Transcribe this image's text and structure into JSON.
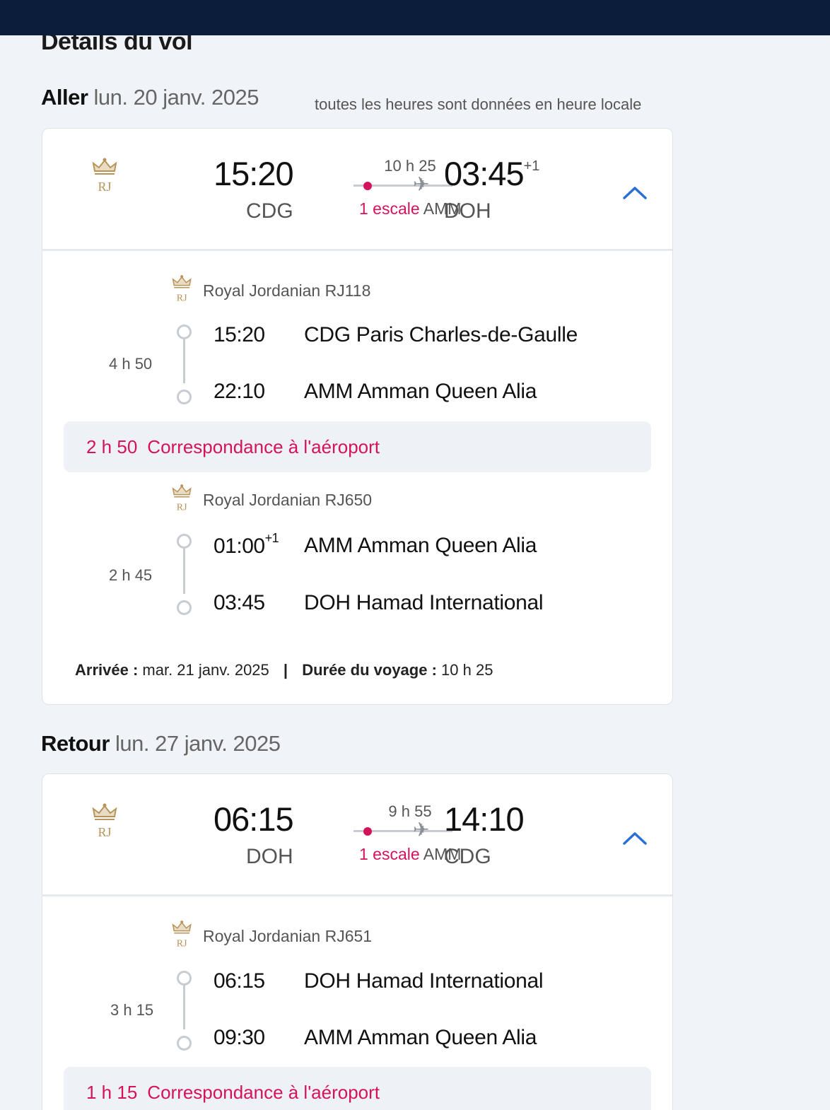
{
  "page": {
    "title": "Détails du vol",
    "timezone_note": "toutes les heures sont données en heure locale"
  },
  "outbound": {
    "label": "Aller",
    "date": "lun. 20 janv. 2025",
    "summary": {
      "dep_time": "15:20",
      "dep_code": "CDG",
      "duration": "10 h 25",
      "stops": "1 escale",
      "stop_code": "AMM",
      "arr_time": "03:45",
      "arr_day_offset": "+1",
      "arr_code": "DOH"
    },
    "segments": [
      {
        "airline": "Royal Jordanian RJ118",
        "duration": "4 h 50",
        "dep_time": "15:20",
        "dep_offset": "",
        "dep_place": "CDG Paris Charles-de-Gaulle",
        "arr_time": "22:10",
        "arr_place": "AMM Amman Queen Alia"
      },
      {
        "airline": "Royal Jordanian RJ650",
        "duration": "2 h 45",
        "dep_time": "01:00",
        "dep_offset": "+1",
        "dep_place": "AMM Amman Queen Alia",
        "arr_time": "03:45",
        "arr_place": "DOH Hamad International"
      }
    ],
    "connection": {
      "duration": "2 h 50",
      "label": "Correspondance à l'aéroport"
    },
    "footer": {
      "arrival_label": "Arrivée :",
      "arrival_value": "mar. 21 janv. 2025",
      "separator": "|",
      "trip_label": "Durée du voyage :",
      "trip_value": "10 h 25"
    }
  },
  "return": {
    "label": "Retour",
    "date": "lun. 27 janv. 2025",
    "summary": {
      "dep_time": "06:15",
      "dep_code": "DOH",
      "duration": "9 h 55",
      "stops": "1 escale",
      "stop_code": "AMM",
      "arr_time": "14:10",
      "arr_day_offset": "",
      "arr_code": "CDG"
    },
    "segments": [
      {
        "airline": "Royal Jordanian RJ651",
        "duration": "3 h 15",
        "dep_time": "06:15",
        "dep_offset": "",
        "dep_place": "DOH Hamad International",
        "arr_time": "09:30",
        "arr_place": "AMM Amman Queen Alia"
      }
    ],
    "connection": {
      "duration": "1 h 15",
      "label": "Correspondance à l'aéroport"
    }
  },
  "icons": {
    "airline_logo": "royal-jordanian-crown-logo",
    "collapse": "chevron-up-icon",
    "plane": "plane-icon",
    "colors": {
      "accent_pink": "#d4145a",
      "chevron_blue": "#2b6fd6",
      "topbar": "#0b1d3a",
      "logo_gold": "#b8945a"
    }
  }
}
